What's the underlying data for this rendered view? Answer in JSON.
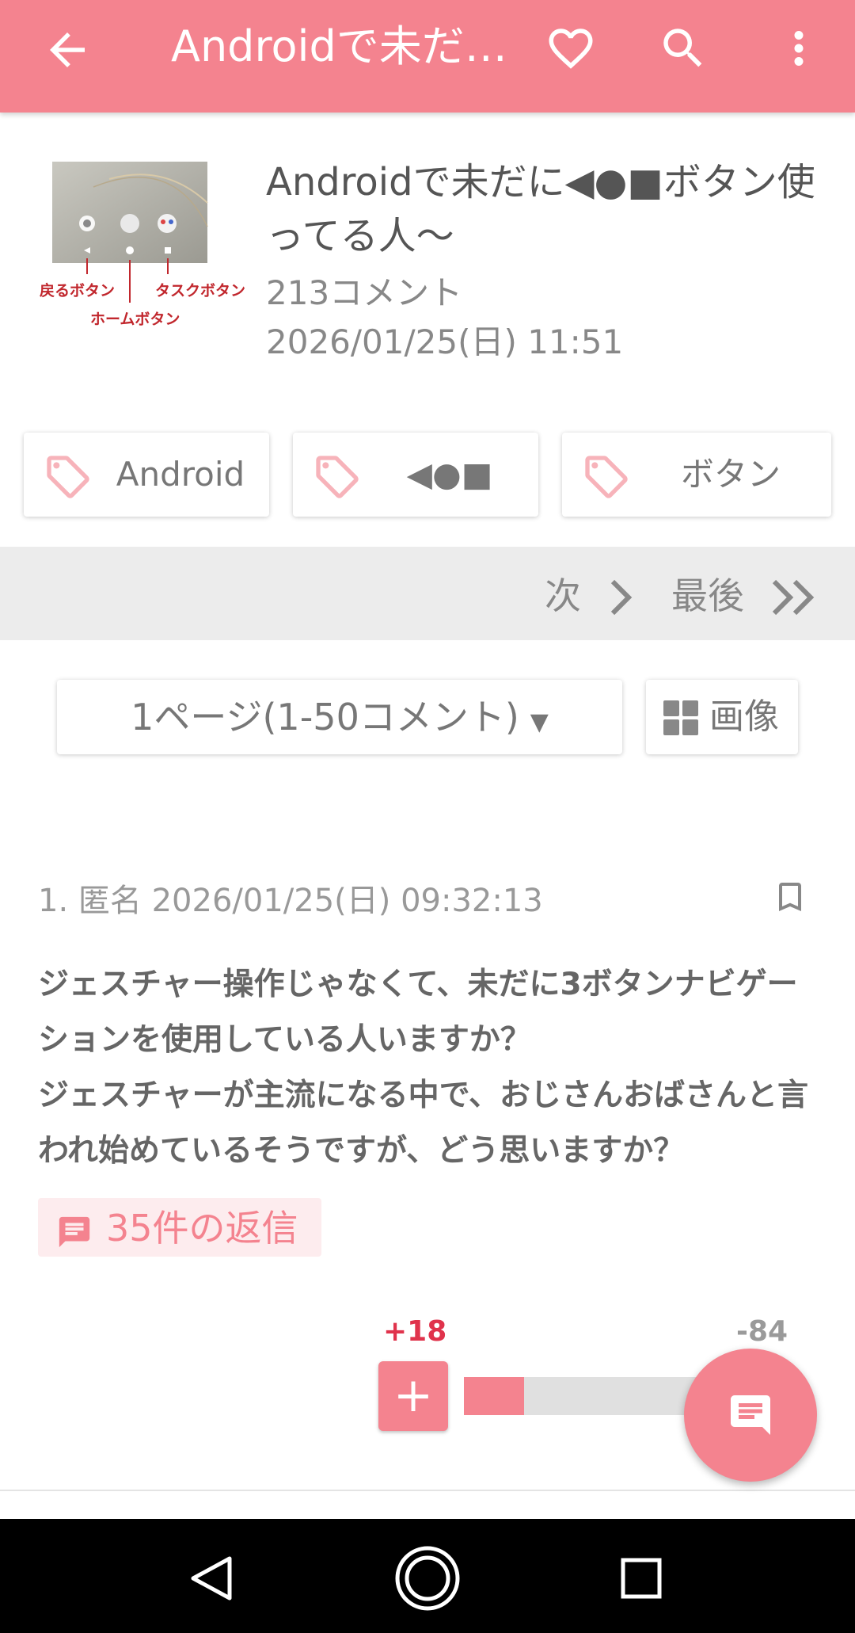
{
  "appbar": {
    "title": "Androidで未だに◀●■ボタン使ってる人〜",
    "icons": [
      "arrow-back-icon",
      "heart-icon",
      "search-icon",
      "more-vert-icon"
    ]
  },
  "article": {
    "thumbnail": {
      "label_back": "戻るボタン",
      "label_home": "ホームボタン",
      "label_task": "タスクボタン"
    },
    "title": "Androidで未だに◀●■ボタン使ってる人〜",
    "comment_count": "213コメント",
    "date": "2026/01/25(日) 11:51"
  },
  "tags": [
    {
      "label": "Android"
    },
    {
      "label": "◀●■"
    },
    {
      "label": "ボタン"
    }
  ],
  "pager": {
    "next": "次",
    "last": "最後"
  },
  "page_select": {
    "value": "1ページ(1-50コメント)",
    "arrow": "▼"
  },
  "image_button": {
    "label": "画像"
  },
  "comment": {
    "meta": "1. 匿名 2026/01/25(日) 09:32:13",
    "body": "ジェスチャー操作じゃなくて、未だに3ボタンナビゲーションを使用している人いますか？\nジェスチャーが主流になる中で、おじさんおばさんと言われ始めているそうですが、どう思いますか？",
    "replies": "35件の返信",
    "plus": "+18",
    "minus": "-84",
    "plus_button": "+",
    "plus_fraction": 0.18
  },
  "colors": {
    "accent": "#f4838f",
    "plus": "#e0334c",
    "minus": "#9a9a9a"
  }
}
